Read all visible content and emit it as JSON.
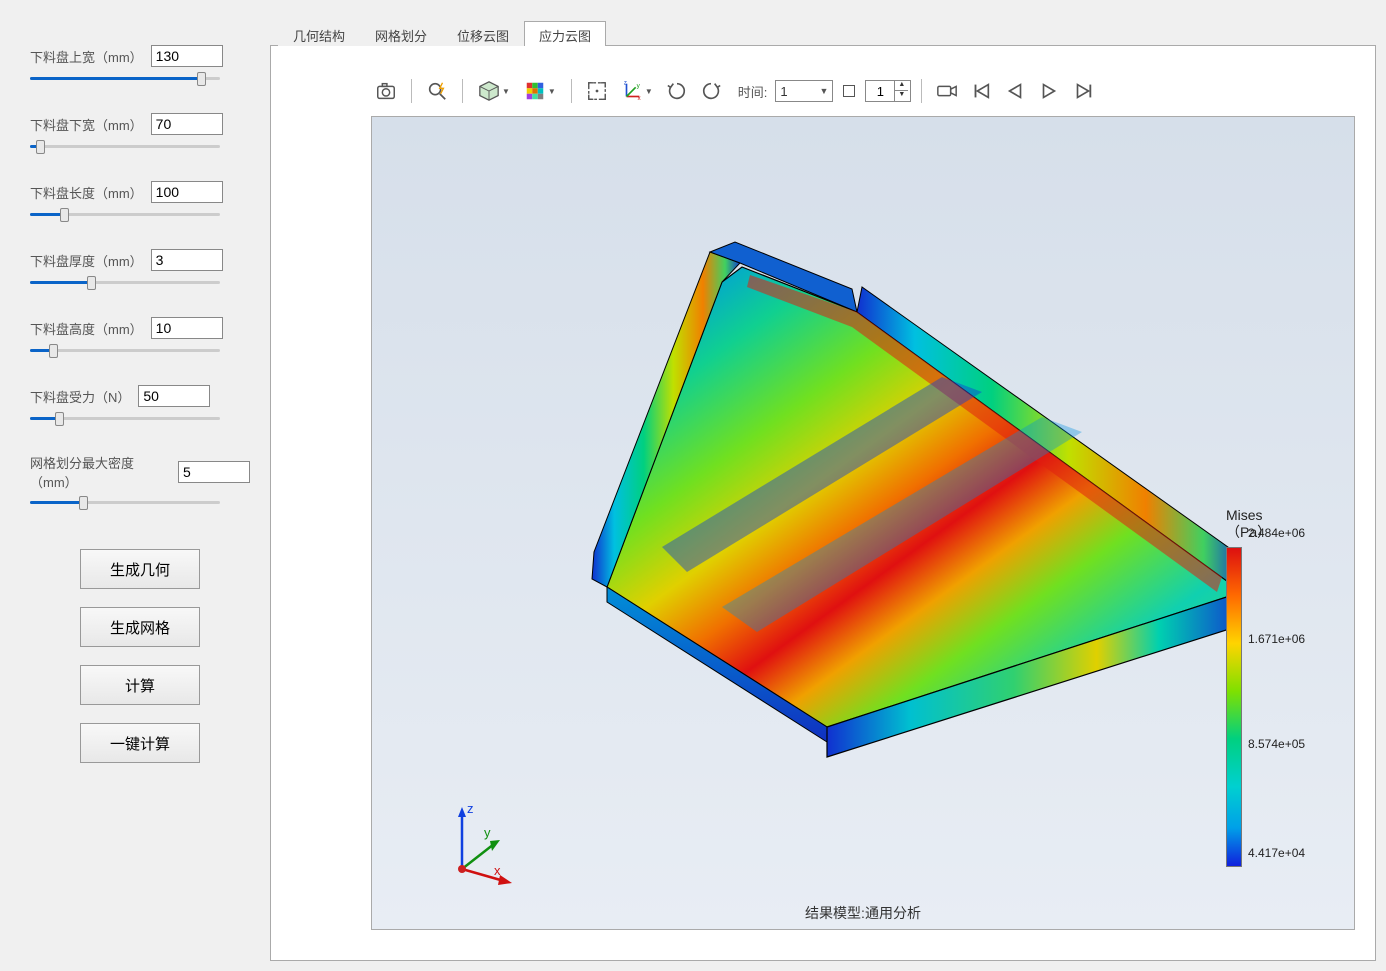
{
  "sidebar": {
    "params": [
      {
        "label": "下料盘上宽（mm）",
        "value": "130",
        "fill": 90
      },
      {
        "label": "下料盘下宽（mm）",
        "value": "70",
        "fill": 5
      },
      {
        "label": "下料盘长度（mm）",
        "value": "100",
        "fill": 18
      },
      {
        "label": "下料盘厚度（mm）",
        "value": "3",
        "fill": 32
      },
      {
        "label": "下料盘高度（mm）",
        "value": "10",
        "fill": 12
      },
      {
        "label": "下料盘受力（N）",
        "value": "50",
        "fill": 15
      },
      {
        "label": "网格划分最大密度（mm）",
        "value": "5",
        "fill": 28
      }
    ],
    "buttons": {
      "gen_geom": "生成几何",
      "gen_mesh": "生成网格",
      "calc": "计算",
      "one_click": "一键计算"
    }
  },
  "tabs": {
    "items": [
      "几何结构",
      "网格划分",
      "位移云图",
      "应力云图"
    ],
    "active": 3
  },
  "toolbar": {
    "time_label": "时间:",
    "time_value": "1",
    "frame_value": "1"
  },
  "legend": {
    "title_line1": "Mises",
    "title_line2": "（Pa）",
    "ticks": [
      {
        "label": "2.484e+06",
        "pct": 0
      },
      {
        "label": "1.671e+06",
        "pct": 33
      },
      {
        "label": "8.574e+05",
        "pct": 66
      },
      {
        "label": "4.417e+04",
        "pct": 100
      }
    ]
  },
  "triad": {
    "x": "x",
    "y": "y",
    "z": "z"
  },
  "footer": "结果模型:通用分析",
  "chart_data": {
    "type": "heatmap",
    "title": "Mises Stress Contour (应力云图)",
    "quantity": "von Mises stress",
    "unit": "Pa",
    "range": [
      44170.0,
      2484000.0
    ],
    "colormap": "rainbow (blue=low, red=high)",
    "legend_ticks": [
      44170.0,
      857400.0,
      1671000.0,
      2484000.0
    ],
    "geometry": "Trapezoidal sheet-metal tray with upturned side flanges",
    "description": "High stress (red/orange) concentrated along the inner bend of the upper flange; low stress (blue) along outer edges and lower flange faces; mid-range (green/cyan) across the sloped plate surface."
  }
}
